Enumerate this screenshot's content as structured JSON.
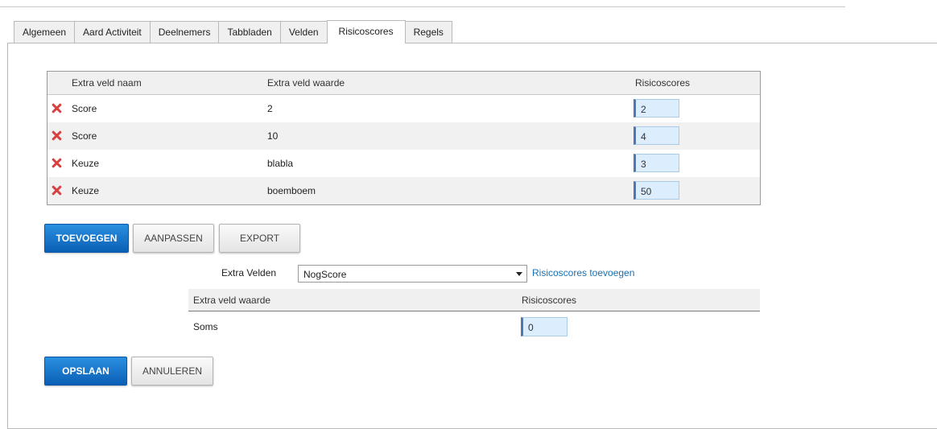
{
  "tabs": [
    "Algemeen",
    "Aard Activiteit",
    "Deelnemers",
    "Tabbladen",
    "Velden",
    "Risicoscores",
    "Regels"
  ],
  "active_tab": "Risicoscores",
  "grid": {
    "headers": [
      "Extra veld naam",
      "Extra veld waarde",
      "Risicoscores"
    ],
    "rows": [
      {
        "name": "Score",
        "value": "2",
        "score": "2"
      },
      {
        "name": "Score",
        "value": "10",
        "score": "4"
      },
      {
        "name": "Keuze",
        "value": "blabla",
        "score": "3"
      },
      {
        "name": "Keuze",
        "value": "boemboem",
        "score": "50"
      }
    ]
  },
  "actions": {
    "add": "TOEVOEGEN",
    "edit": "AANPASSEN",
    "export": "EXPORT"
  },
  "extra_fields": {
    "label": "Extra Velden",
    "selected": "NogScore",
    "add_link": "Risicoscores toevoegen"
  },
  "subgrid": {
    "headers": [
      "Extra veld waarde",
      "Risicoscores"
    ],
    "rows": [
      {
        "value": "Soms",
        "score": "0"
      }
    ]
  },
  "footer": {
    "save": "OPSLAAN",
    "cancel": "ANNULEREN"
  },
  "colors": {
    "primary_button": "#1271c8",
    "delete_icon": "#d94040",
    "link": "#1a6fb0",
    "input_bg": "#dceefd"
  }
}
